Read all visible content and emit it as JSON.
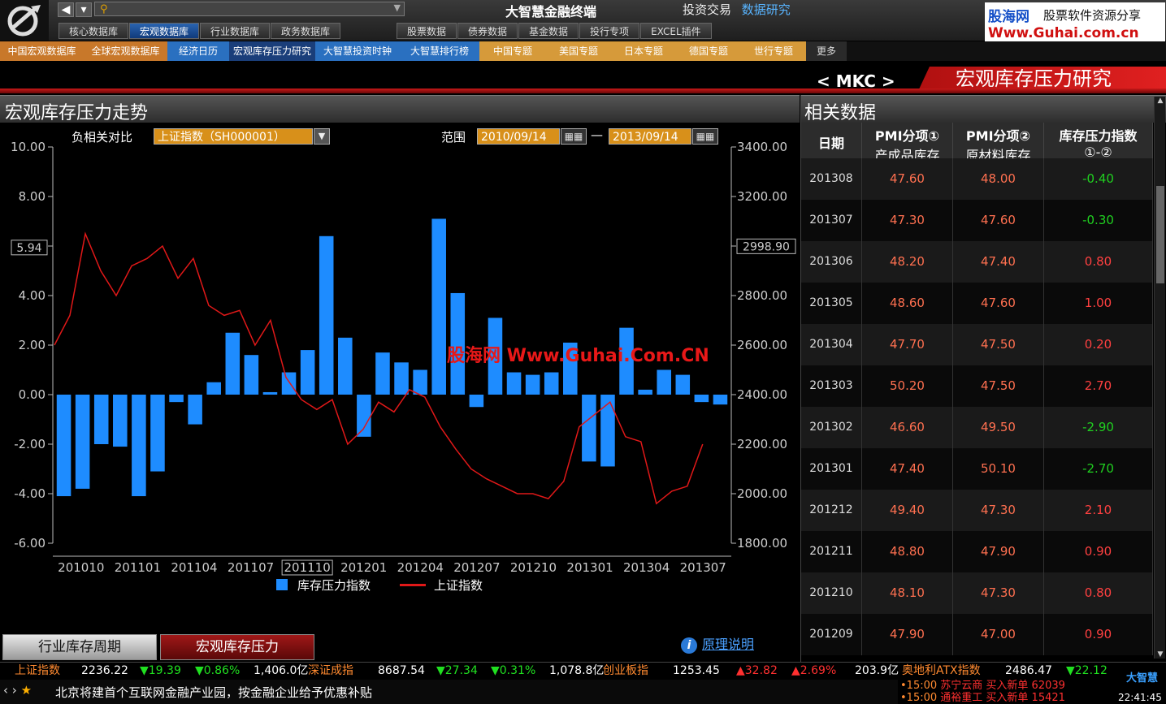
{
  "app": {
    "title": "大智慧金融终端",
    "top_links": [
      "投资交易",
      "数据研究"
    ]
  },
  "brand_banner": {
    "name": "股海网",
    "slogan": "股票软件资源分享",
    "url": "Www.Guhai.com.cn"
  },
  "db_tabs_left": [
    "核心数据库",
    "宏观数据库",
    "行业数据库",
    "政务数据库"
  ],
  "db_tabs_right": [
    "股票数据",
    "债券数据",
    "基金数据",
    "投行专项",
    "EXCEL插件"
  ],
  "subnav": [
    "中国宏观数据库",
    "全球宏观数据库",
    "经济日历",
    "宏观库存压力研究",
    "大智慧投资时钟",
    "大智慧排行榜",
    "中国专题",
    "美国专题",
    "日本专题",
    "德国专题",
    "世行专题",
    "更多"
  ],
  "header": {
    "mkc": "< MKC >",
    "page_title": "宏观库存压力研究"
  },
  "left_panel": {
    "title": "宏观库存压力走势",
    "compare_label": "负相关对比",
    "compare_value": "上证指数（SH000001）",
    "range_label": "范围",
    "range_start": "2010/09/14",
    "range_sep": "—",
    "range_end": "2013/09/14",
    "watermark": "股海网 Www.Guhai.Com.CN",
    "explain_link": "原理说明",
    "bottom_tabs": [
      "行业库存周期",
      "宏观库存压力"
    ]
  },
  "chart_data": {
    "type": "bar",
    "title": "",
    "left_axis": {
      "range": [
        -6,
        10
      ],
      "ticks": [
        "10.00",
        "8.00",
        "6.00",
        "4.00",
        "2.00",
        "0.00",
        "-2.00",
        "-4.00",
        "-6.00"
      ],
      "cursor_label": "5.94"
    },
    "right_axis": {
      "range": [
        1800,
        3400
      ],
      "ticks": [
        "3400.00",
        "3200.00",
        "3000.00",
        "2800.00",
        "2600.00",
        "2400.00",
        "2200.00",
        "2000.00",
        "1800.00"
      ],
      "cursor_label": "2998.90"
    },
    "x_labels": [
      "201010",
      "201101",
      "201104",
      "201107",
      "201110",
      "201201",
      "201204",
      "201207",
      "201210",
      "201301",
      "201304",
      "201307"
    ],
    "x_selected": "201110",
    "series": [
      {
        "name": "库存压力指数",
        "type": "bar",
        "color": "#1e8cff",
        "values": [
          -4.1,
          -3.8,
          -2.0,
          -2.1,
          -4.1,
          -3.1,
          -0.3,
          -1.2,
          0.5,
          2.5,
          1.6,
          0.1,
          0.9,
          1.8,
          6.4,
          2.3,
          -1.7,
          1.7,
          1.3,
          1.0,
          7.1,
          4.1,
          -0.5,
          3.1,
          0.9,
          0.8,
          0.9,
          2.1,
          -2.7,
          -2.9,
          2.7,
          0.2,
          1.0,
          0.8,
          -0.3,
          -0.4
        ]
      },
      {
        "name": "上证指数",
        "type": "line",
        "color": "#e01818",
        "values": [
          2600,
          2720,
          3050,
          2900,
          2800,
          2920,
          2950,
          3000,
          2870,
          2950,
          2760,
          2720,
          2740,
          2600,
          2700,
          2470,
          2380,
          2340,
          2380,
          2200,
          2260,
          2370,
          2330,
          2420,
          2390,
          2270,
          2180,
          2100,
          2060,
          2030,
          2000,
          2000,
          1980,
          2050,
          2270,
          2320,
          2370,
          2230,
          2210,
          1960,
          2010,
          2030,
          2200
        ]
      }
    ],
    "legend": [
      "库存压力指数",
      "上证指数"
    ],
    "legend_position": "bottom"
  },
  "right_panel": {
    "title": "相关数据",
    "headers": [
      {
        "h1": "日期",
        "h2": ""
      },
      {
        "h1": "PMI分项①",
        "h2": "产成品库存"
      },
      {
        "h1": "PMI分项②",
        "h2": "原材料库存"
      },
      {
        "h1": "库存压力指数",
        "h2": "①-②"
      }
    ],
    "rows": [
      {
        "date": "201308",
        "a": "47.60",
        "b": "48.00",
        "c": "-0.40",
        "sign": "neg"
      },
      {
        "date": "201307",
        "a": "47.30",
        "b": "47.60",
        "c": "-0.30",
        "sign": "neg"
      },
      {
        "date": "201306",
        "a": "48.20",
        "b": "47.40",
        "c": "0.80",
        "sign": "pos"
      },
      {
        "date": "201305",
        "a": "48.60",
        "b": "47.60",
        "c": "1.00",
        "sign": "pos"
      },
      {
        "date": "201304",
        "a": "47.70",
        "b": "47.50",
        "c": "0.20",
        "sign": "pos"
      },
      {
        "date": "201303",
        "a": "50.20",
        "b": "47.50",
        "c": "2.70",
        "sign": "pos"
      },
      {
        "date": "201302",
        "a": "46.60",
        "b": "49.50",
        "c": "-2.90",
        "sign": "neg"
      },
      {
        "date": "201301",
        "a": "47.40",
        "b": "50.10",
        "c": "-2.70",
        "sign": "neg"
      },
      {
        "date": "201212",
        "a": "49.40",
        "b": "47.30",
        "c": "2.10",
        "sign": "pos"
      },
      {
        "date": "201211",
        "a": "48.80",
        "b": "47.90",
        "c": "0.90",
        "sign": "pos"
      },
      {
        "date": "201210",
        "a": "48.10",
        "b": "47.30",
        "c": "0.80",
        "sign": "pos"
      },
      {
        "date": "201209",
        "a": "47.90",
        "b": "47.00",
        "c": "0.90",
        "sign": "pos"
      }
    ]
  },
  "ticker": {
    "items": [
      {
        "name": "上证指数",
        "price": "2236.22",
        "chg": "▼19.39",
        "pct": "▼0.86%",
        "amt": "1,406.0亿",
        "dir": "dn"
      },
      {
        "name": "深证成指",
        "price": "8687.54",
        "chg": "▼27.34",
        "pct": "▼0.31%",
        "amt": "1,078.8亿",
        "dir": "dn"
      },
      {
        "name": "创业板指",
        "price": "1253.45",
        "chg": "▲32.82",
        "pct": "▲2.69%",
        "amt": "203.9亿",
        "dir": "up"
      },
      {
        "name": "奥地利ATX指数",
        "price": "2486.47",
        "chg": "▼22.12",
        "pct": "",
        "amt": "",
        "dir": "dn"
      }
    ],
    "news": "北京将建首个互联网金融产业园，按金融企业给予优惠补贴",
    "alerts": [
      {
        "time": "•15:00",
        "text": "苏宁云商 买入新单 62039"
      },
      {
        "time": "•15:00",
        "text": "通裕重工 买入新单 15421"
      }
    ],
    "mini_brand": "大智慧",
    "clock": "22:41:45"
  }
}
